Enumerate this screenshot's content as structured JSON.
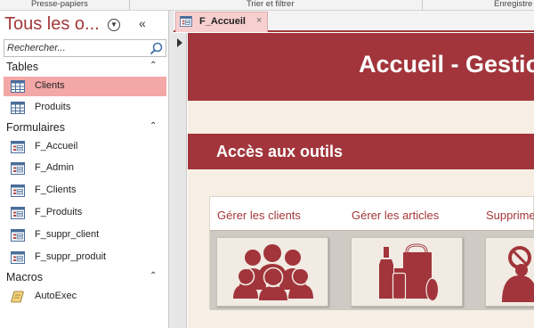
{
  "ribbon": {
    "groups": [
      "Presse-papiers",
      "Trier et filtrer",
      "Enregistre"
    ]
  },
  "nav": {
    "title": "Tous les o...",
    "search_placeholder": "Rechercher...",
    "categories": [
      {
        "label": "Tables",
        "items": [
          {
            "label": "Clients",
            "selected": true,
            "icon": "table-icon"
          },
          {
            "label": "Produits",
            "icon": "table-icon"
          }
        ]
      },
      {
        "label": "Formulaires",
        "items": [
          {
            "label": "F_Accueil",
            "icon": "form-icon"
          },
          {
            "label": "F_Admin",
            "icon": "form-icon"
          },
          {
            "label": "F_Clients",
            "icon": "form-icon"
          },
          {
            "label": "F_Produits",
            "icon": "form-icon"
          },
          {
            "label": "F_suppr_client",
            "icon": "form-icon"
          },
          {
            "label": "F_suppr_produit",
            "icon": "form-icon"
          }
        ]
      },
      {
        "label": "Macros",
        "items": [
          {
            "label": "AutoExec",
            "icon": "macro-icon"
          }
        ]
      }
    ]
  },
  "tab": {
    "label": "F_Accueil",
    "close": "×"
  },
  "form": {
    "title": "Accueil - Gestio",
    "section_title": "Accès aux outils",
    "tools": [
      {
        "label": "Gérer les clients",
        "icon": "people-icon"
      },
      {
        "label": "Gérer les articles",
        "icon": "bottles-icon"
      },
      {
        "label": "Supprime",
        "icon": "delete-icon"
      }
    ]
  },
  "colors": {
    "accent": "#a1353b",
    "selection": "#f4a7a7",
    "form_bg": "#f7efe3"
  }
}
